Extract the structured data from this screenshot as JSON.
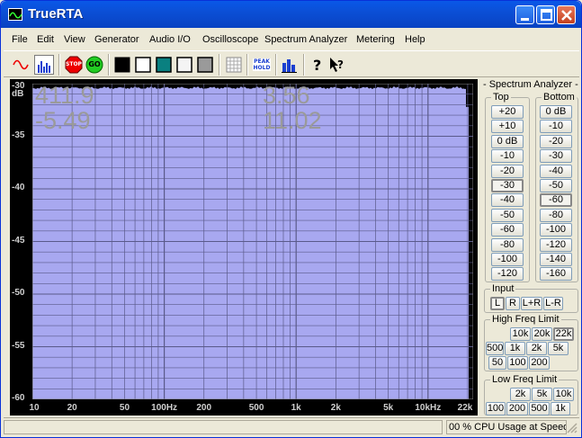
{
  "window": {
    "title": "TrueRTA"
  },
  "menu": [
    "File",
    "Edit",
    "View",
    "Generator",
    "Audio I/O",
    "Oscilloscope",
    "Spectrum Analyzer",
    "Metering",
    "Help"
  ],
  "toolbar": {
    "icons": [
      "sine-wave-icon",
      "spectrum-bars-icon",
      "stop-icon",
      "go-icon",
      "black-bg-icon",
      "white-bg-icon",
      "teal-bg-icon",
      "white-bg-2-icon",
      "gray-bg-icon",
      "grid-icon",
      "peak-hold-icon",
      "bar-graph-icon",
      "help-icon",
      "context-help-icon"
    ],
    "stop_label": "STOP",
    "go_label": "GO",
    "peak_label_1": "PEAK",
    "peak_label_2": "HOLD"
  },
  "colors": {
    "plot_fill": "#a8a8f0",
    "plot_bg": "#000000",
    "grid": "#5a5a8a",
    "titlebar": "#0b4fd6"
  },
  "readouts": {
    "left_top_value": "411.9",
    "left_bottom_value": "-5.49",
    "center_top_value": "3.56",
    "center_bottom_value": "11.02"
  },
  "chart_data": {
    "type": "bar",
    "title": "",
    "y_ticks": [
      "-30\ndB",
      "-35",
      "-40",
      "-45",
      "-50",
      "-55",
      "-60"
    ],
    "x_ticks": [
      "10",
      "20",
      "50",
      "100Hz",
      "200",
      "500",
      "1k",
      "2k",
      "5k",
      "10kHz",
      "22k"
    ],
    "ylim": [
      -60,
      -30
    ],
    "xlim_hz": [
      10,
      22000
    ],
    "grid": true,
    "level_db": -30.5
  },
  "panel": {
    "title": "- Spectrum Analyzer -",
    "top_label": "Top",
    "bottom_label": "Bottom",
    "top_buttons": [
      "+20",
      "+10",
      "0 dB",
      "-10",
      "-20",
      "-30",
      "-40",
      "-50",
      "-60",
      "-80",
      "-100",
      "-120"
    ],
    "top_selected": "-30",
    "bottom_buttons": [
      "0 dB",
      "-10",
      "-20",
      "-30",
      "-40",
      "-50",
      "-60",
      "-80",
      "-100",
      "-120",
      "-140",
      "-160"
    ],
    "bottom_selected": "-60",
    "input_title": "Input",
    "input_buttons": [
      "L",
      "R",
      "L+R",
      "L-R"
    ],
    "input_selected": "L",
    "high_title": "High Freq Limit",
    "high_row1": [
      "10k",
      "20k",
      "22k"
    ],
    "high_row2": [
      "500",
      "1k",
      "2k",
      "5k"
    ],
    "high_row3": [
      "50",
      "100",
      "200"
    ],
    "high_selected": "22k",
    "low_title": "Low Freq Limit",
    "low_row1": [
      "2k",
      "5k",
      "10k"
    ],
    "low_row2": [
      "100",
      "200",
      "500",
      "1k"
    ]
  },
  "status": {
    "cpu": "00 % CPU Usage at Speed"
  }
}
